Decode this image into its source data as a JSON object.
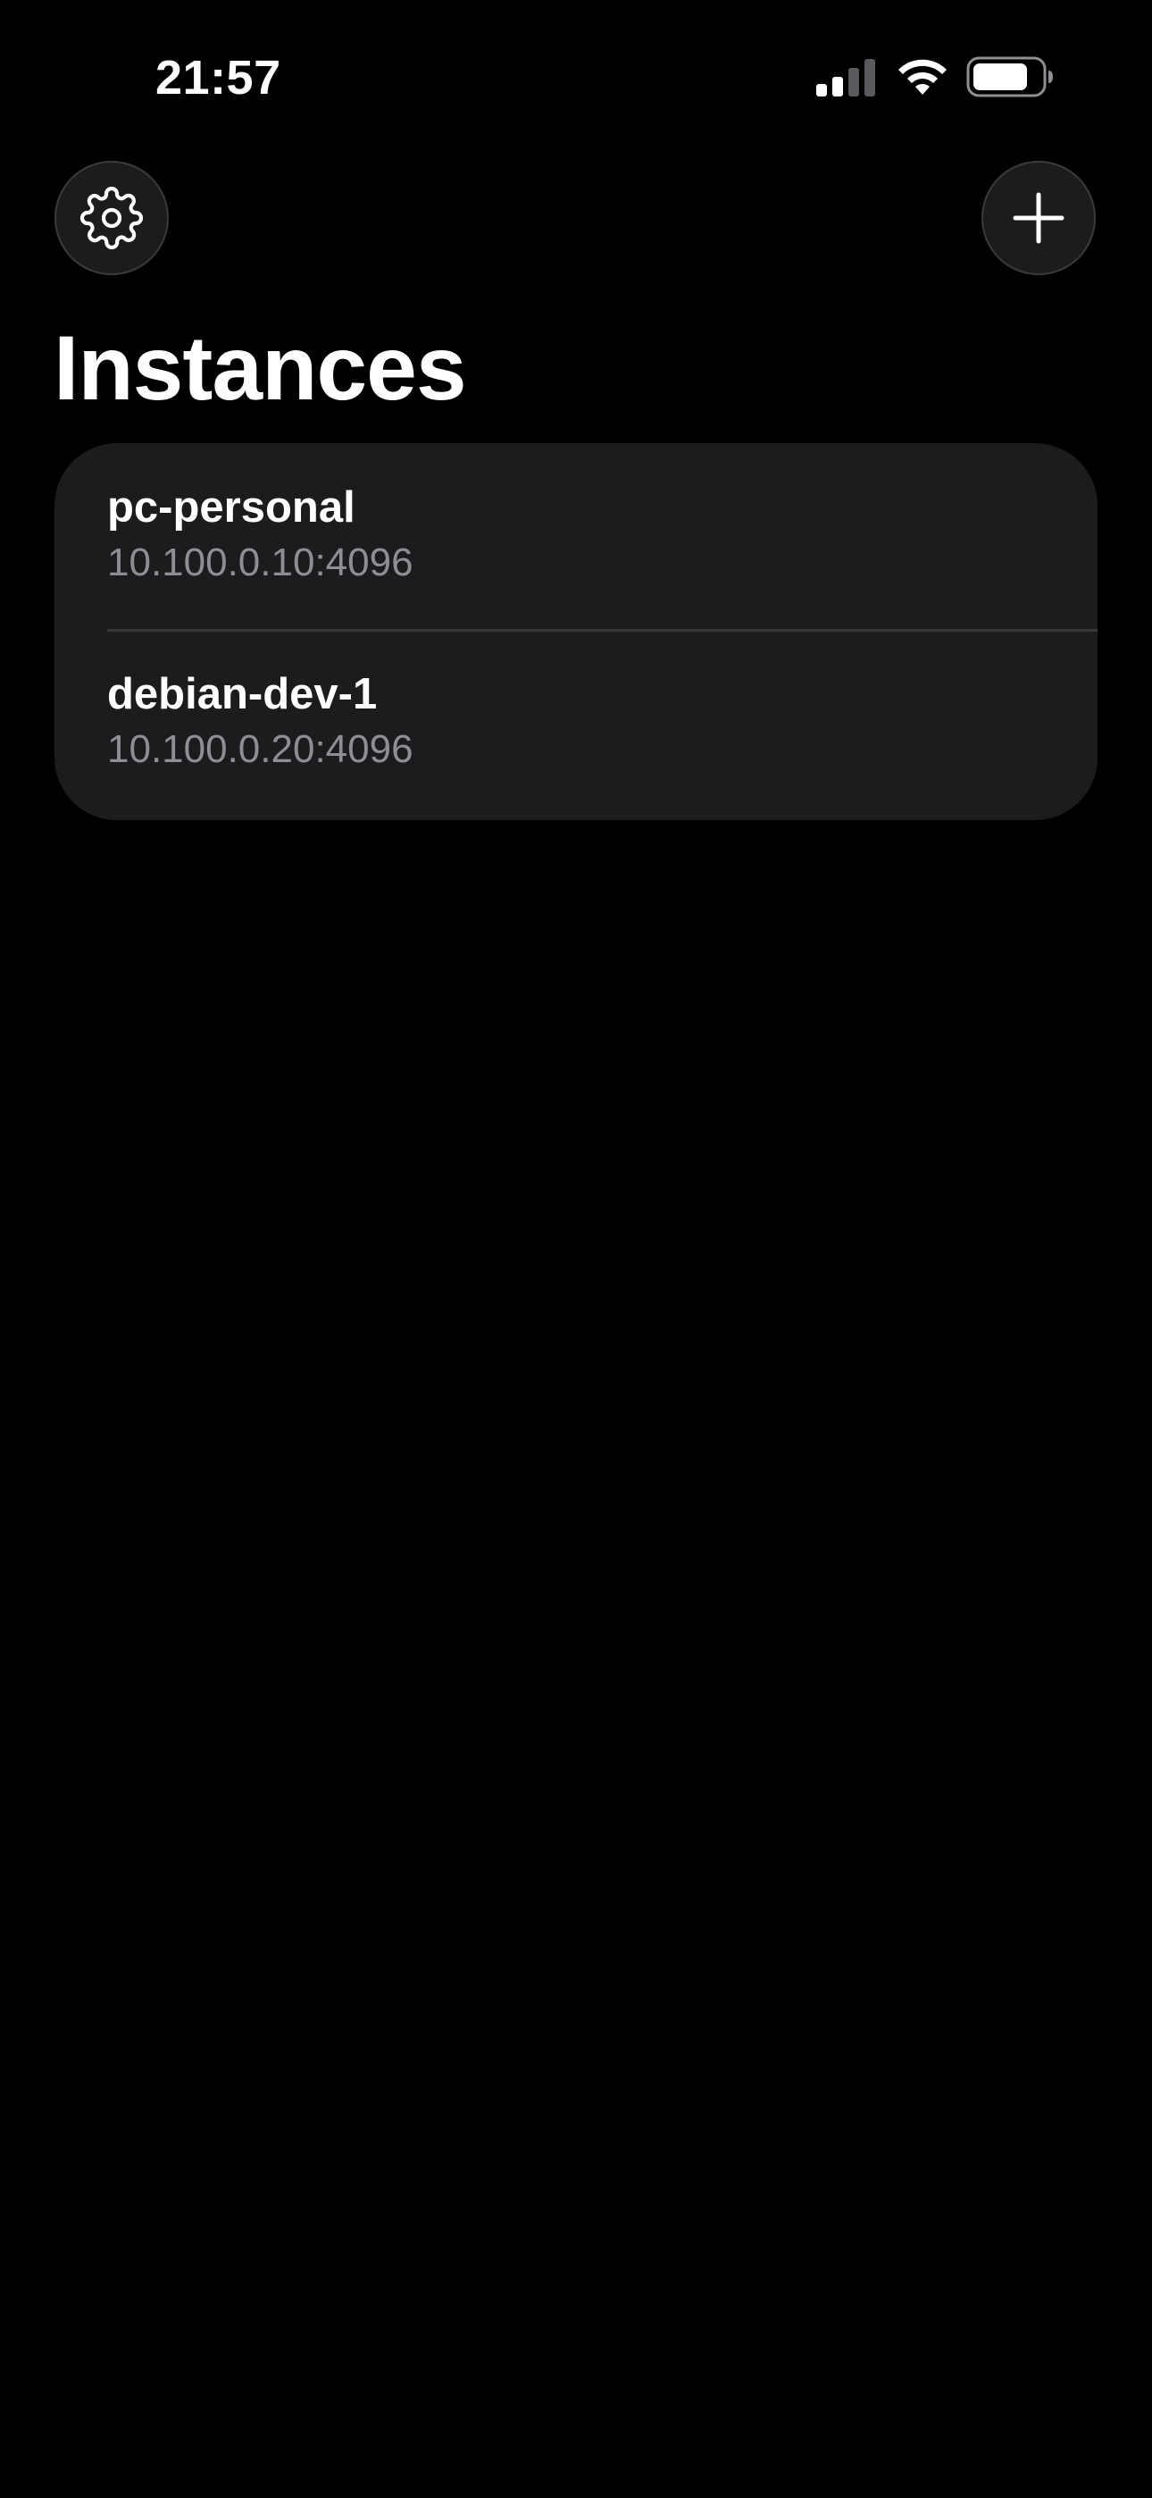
{
  "status_bar": {
    "time": "21:57"
  },
  "header": {
    "title": "Instances",
    "settings_icon": "gear-icon",
    "add_icon": "plus-icon"
  },
  "instances": [
    {
      "name": "pc-personal",
      "address": "10.100.0.10:4096"
    },
    {
      "name": "debian-dev-1",
      "address": "10.100.0.20:4096"
    }
  ],
  "colors": {
    "background": "#000000",
    "card": "#1c1c1e",
    "primary_text": "#ffffff",
    "secondary_text": "#8e8e93",
    "divider": "#38383a"
  }
}
